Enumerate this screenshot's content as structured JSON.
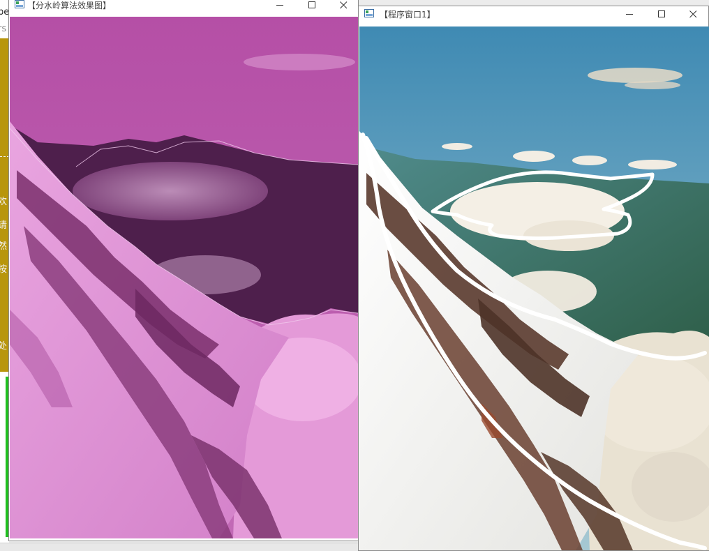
{
  "background_app": {
    "lines": [
      "pe",
      "rs",
      "欢",
      "请",
      "然",
      "按",
      "处"
    ]
  },
  "left_window": {
    "title": "【分水岭算法效果图】",
    "image_icon": "image-window-icon",
    "controls": {
      "minimize": "minimize-icon",
      "maximize": "maximize-icon",
      "close": "close-icon"
    }
  },
  "right_window": {
    "title": "【程序窗口1】",
    "image_icon": "image-window-icon",
    "controls": {
      "minimize": "minimize-icon",
      "maximize": "maximize-icon",
      "close": "close-icon"
    }
  },
  "colors": {
    "overlay_magenta": "#c050b0",
    "overlay_dark": "#5a2456",
    "sky_blue": "#4d93b8",
    "stroke_white": "#ffffff",
    "rock_brown": "#5a3a2e"
  }
}
